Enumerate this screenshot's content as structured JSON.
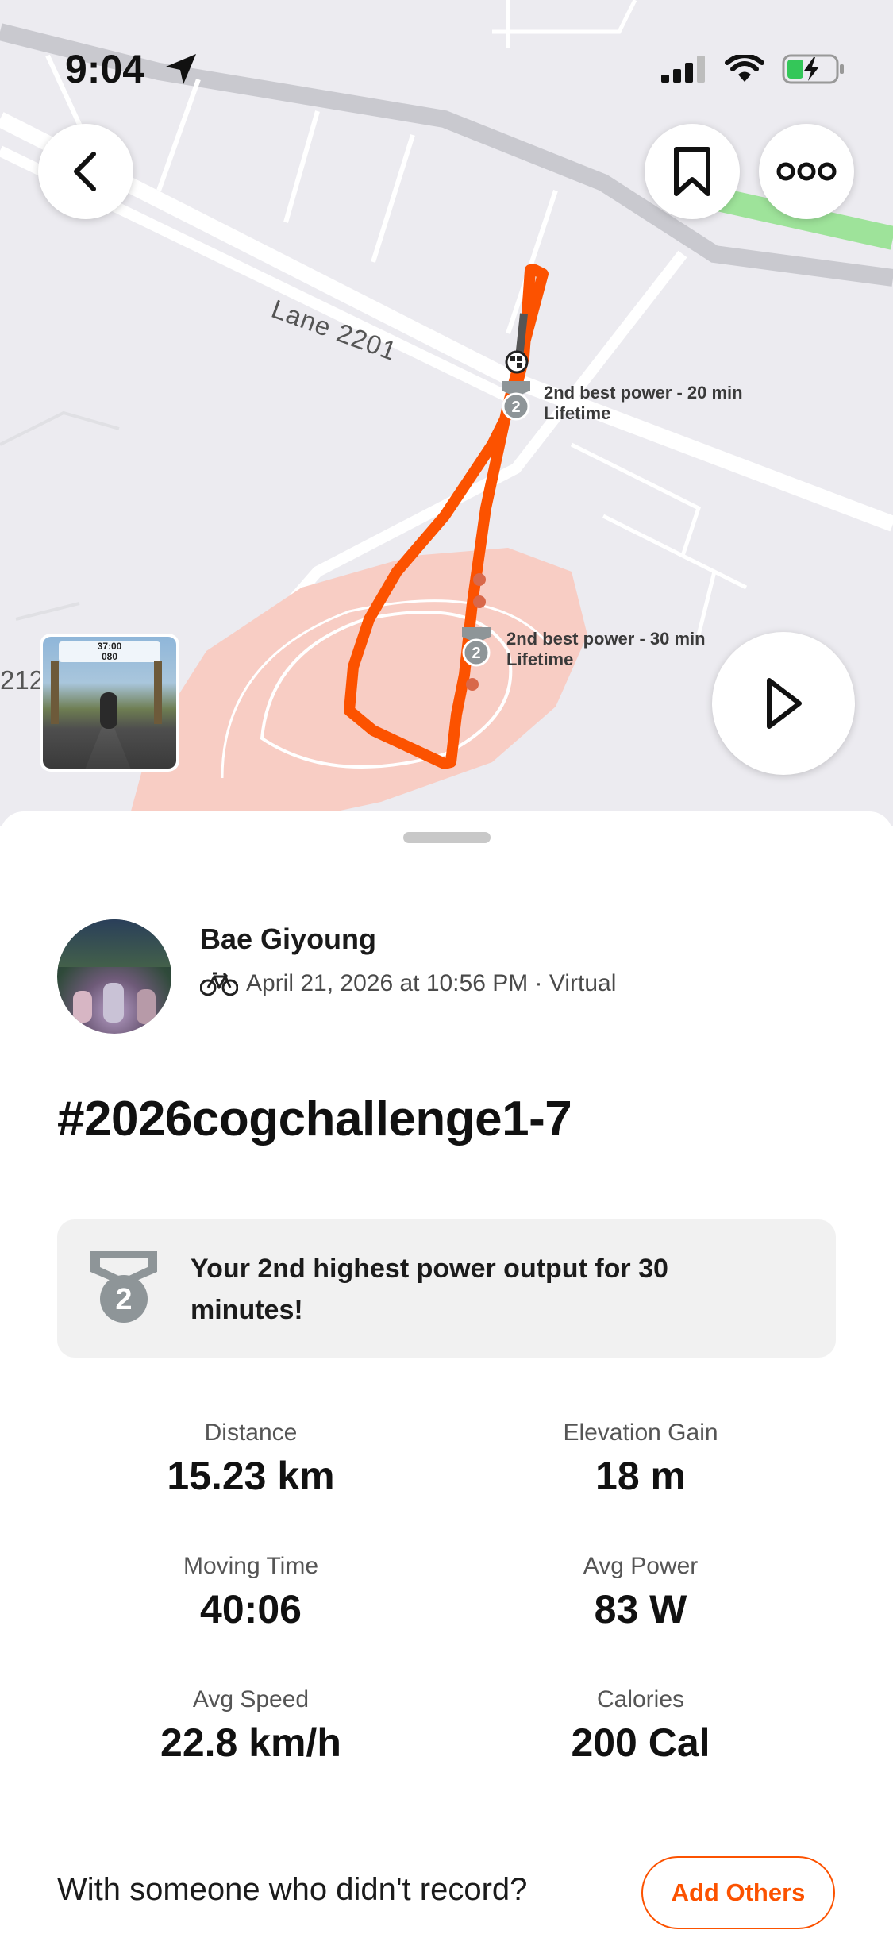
{
  "status_bar": {
    "time": "9:04",
    "icons": [
      "location-arrow-icon",
      "signal-icon",
      "wifi-icon",
      "battery-charging-icon"
    ]
  },
  "map": {
    "road_label": "Lane 2201",
    "road_label_partial": "212",
    "achievements": [
      {
        "line1": "2nd best power - 20 min",
        "line2": "Lifetime",
        "rank": "2"
      },
      {
        "line1": "2nd best power - 30 min",
        "line2": "Lifetime",
        "rank": "2"
      }
    ],
    "route_color": "#fc5200"
  },
  "thumbnail": {
    "timer": "37:00",
    "speed": "080"
  },
  "activity": {
    "athlete_name": "Bae Giyoung",
    "meta": "April 21, 2026 at 10:56 PM · Virtual",
    "title": "#2026cogchallenge1-7",
    "achievement_text": "Your 2nd highest power output for 30 minutes!",
    "achievement_rank": "2"
  },
  "stats": [
    {
      "label": "Distance",
      "value": "15.23 km"
    },
    {
      "label": "Elevation Gain",
      "value": "18 m"
    },
    {
      "label": "Moving Time",
      "value": "40:06"
    },
    {
      "label": "Avg Power",
      "value": "83 W"
    },
    {
      "label": "Avg Speed",
      "value": "22.8 km/h"
    },
    {
      "label": "Calories",
      "value": "200 Cal"
    }
  ],
  "footer": {
    "prompt": "With someone who didn't record?",
    "button": "Add Others"
  },
  "colors": {
    "accent": "#fc5200",
    "medal": "#8e9598"
  }
}
